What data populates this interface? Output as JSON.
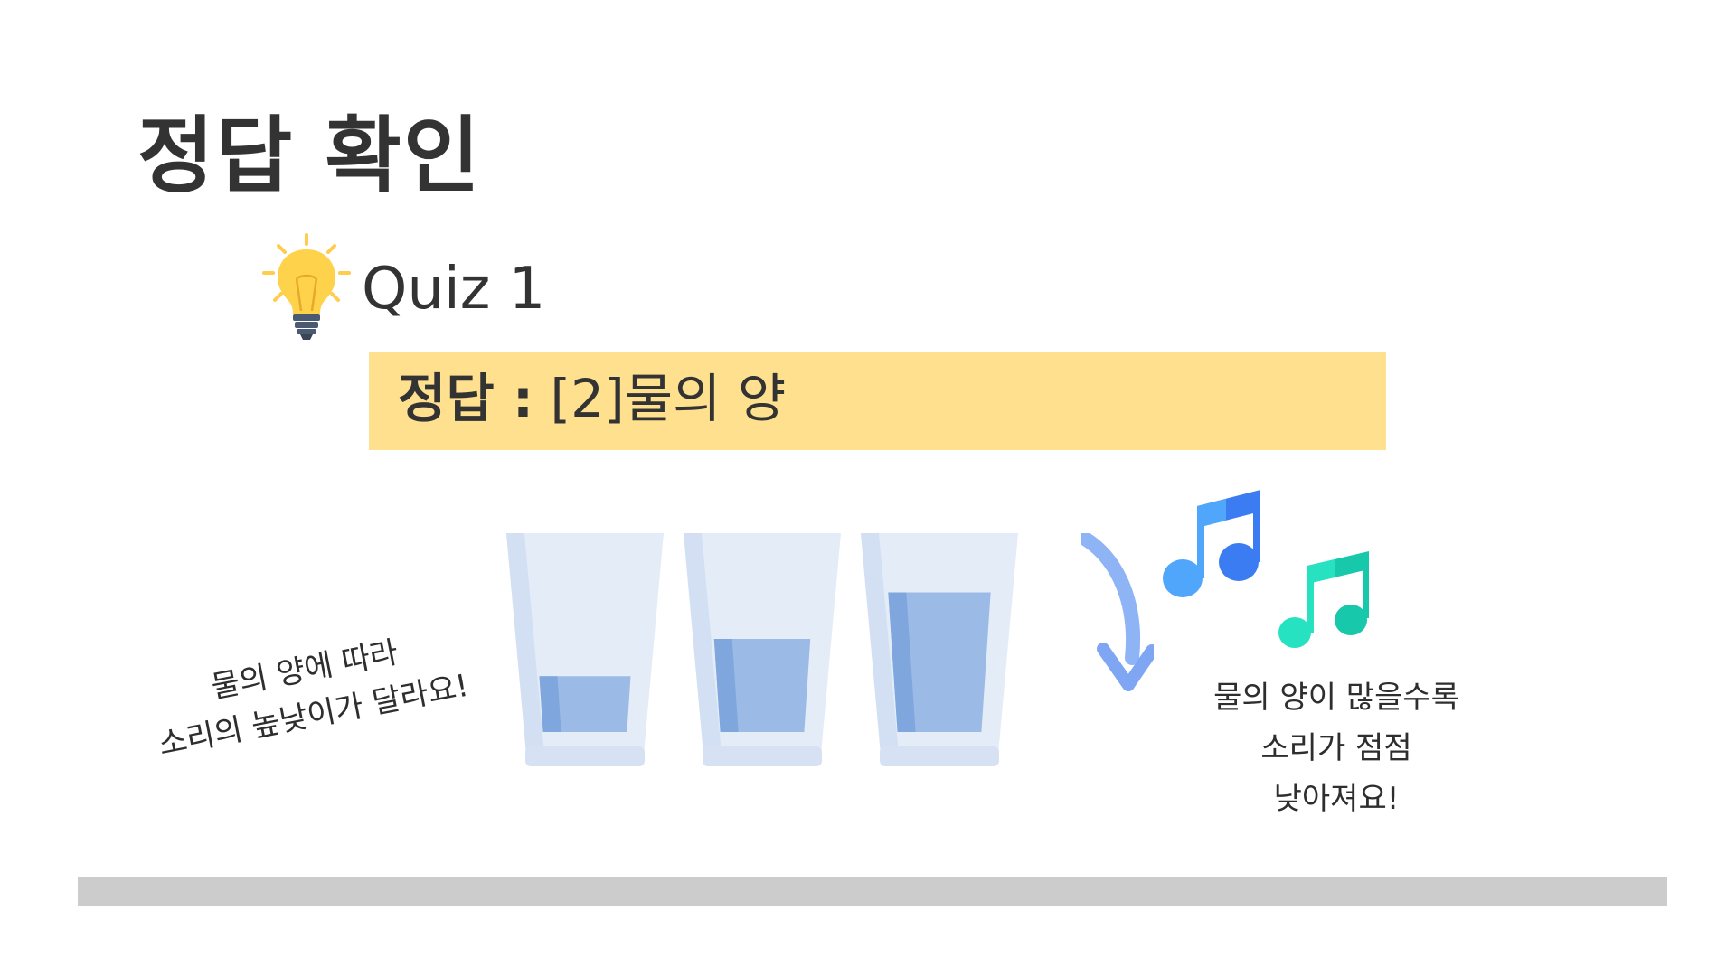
{
  "title": "정답 확인",
  "quiz": {
    "label": "Quiz 1",
    "icon": "lightbulb-icon"
  },
  "answer": {
    "label": "정답 :",
    "value": "[2]물의 양",
    "background": "#ffe08f"
  },
  "glasses": {
    "water_levels": [
      0.3,
      0.5,
      0.75
    ],
    "water_color": "#9bbbe6",
    "glass_color": "#e4ecf8"
  },
  "notes_left": {
    "line1": "물의 양에 따라",
    "line2": "소리의 높낮이가 달라요!"
  },
  "notes_right": {
    "line1": "물의 양이 많을수록",
    "line2": "소리가 점점",
    "line3": "낮아져요!"
  },
  "icons": {
    "arrow": "curved-arrow-down-icon",
    "music_notes": "music-notes-icon"
  },
  "colors": {
    "title_text": "#333333",
    "bottom_bar": "#cccccc",
    "note_blue": "#3d86f5",
    "note_teal": "#1cd6b5"
  }
}
